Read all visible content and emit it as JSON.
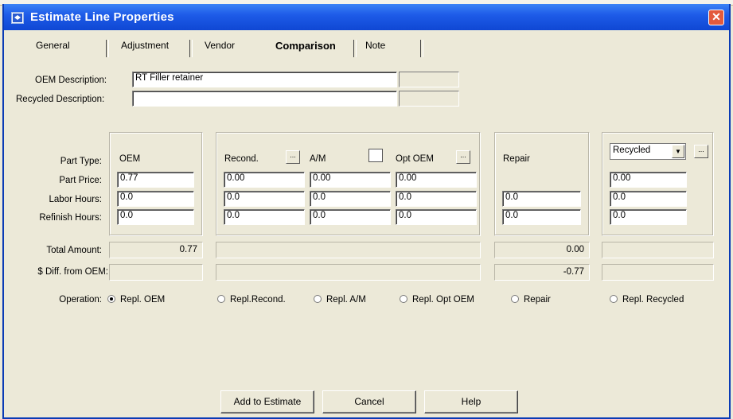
{
  "window": {
    "title": "Estimate Line Properties",
    "close_glyph": "✕"
  },
  "tabs": [
    "General",
    "Adjustment",
    "Vendor",
    "Comparison",
    "Note"
  ],
  "active_tab": "Comparison",
  "descriptions": {
    "oem_label": "OEM Description:",
    "oem_value": "RT Filler retainer",
    "recycled_label": "Recycled Description:",
    "recycled_value": ""
  },
  "row_labels": {
    "part_type": "Part Type:",
    "part_price": "Part Price:",
    "labor_hours": "Labor Hours:",
    "refinish_hours": "Refinish Hours:",
    "total_amount": "Total Amount:",
    "diff_from_oem": "$ Diff. from OEM:"
  },
  "columns": {
    "oem": {
      "header": "OEM",
      "part_price": "0.77",
      "labor_hours": "0.0",
      "refinish_hours": "0.0"
    },
    "recond": {
      "header": "Recond.",
      "button": "...",
      "part_price": "0.00",
      "labor_hours": "0.0",
      "refinish_hours": "0.0"
    },
    "am": {
      "header": "A/M",
      "part_price": "0.00",
      "labor_hours": "0.0",
      "refinish_hours": "0.0"
    },
    "opt_oem": {
      "header": "Opt OEM",
      "button": "...",
      "part_price": "0.00",
      "labor_hours": "0.0",
      "refinish_hours": "0.0"
    },
    "repair": {
      "header": "Repair",
      "labor_hours": "0.0",
      "refinish_hours": "0.0"
    },
    "recycled": {
      "selected": "Recycled",
      "button": "...",
      "part_price": "0.00",
      "labor_hours": "0.0",
      "refinish_hours": "0.0"
    }
  },
  "totals": {
    "oem_total": "0.77",
    "repair_total": "0.00",
    "repair_diff": "-0.77"
  },
  "operation": {
    "label": "Operation:",
    "selected": "Repl. OEM",
    "options": [
      "Repl. OEM",
      "Repl.Recond.",
      "Repl. A/M",
      "Repl. Opt OEM",
      "Repair",
      "Repl. Recycled"
    ]
  },
  "buttons": {
    "add": "Add to Estimate",
    "cancel": "Cancel",
    "help": "Help"
  }
}
